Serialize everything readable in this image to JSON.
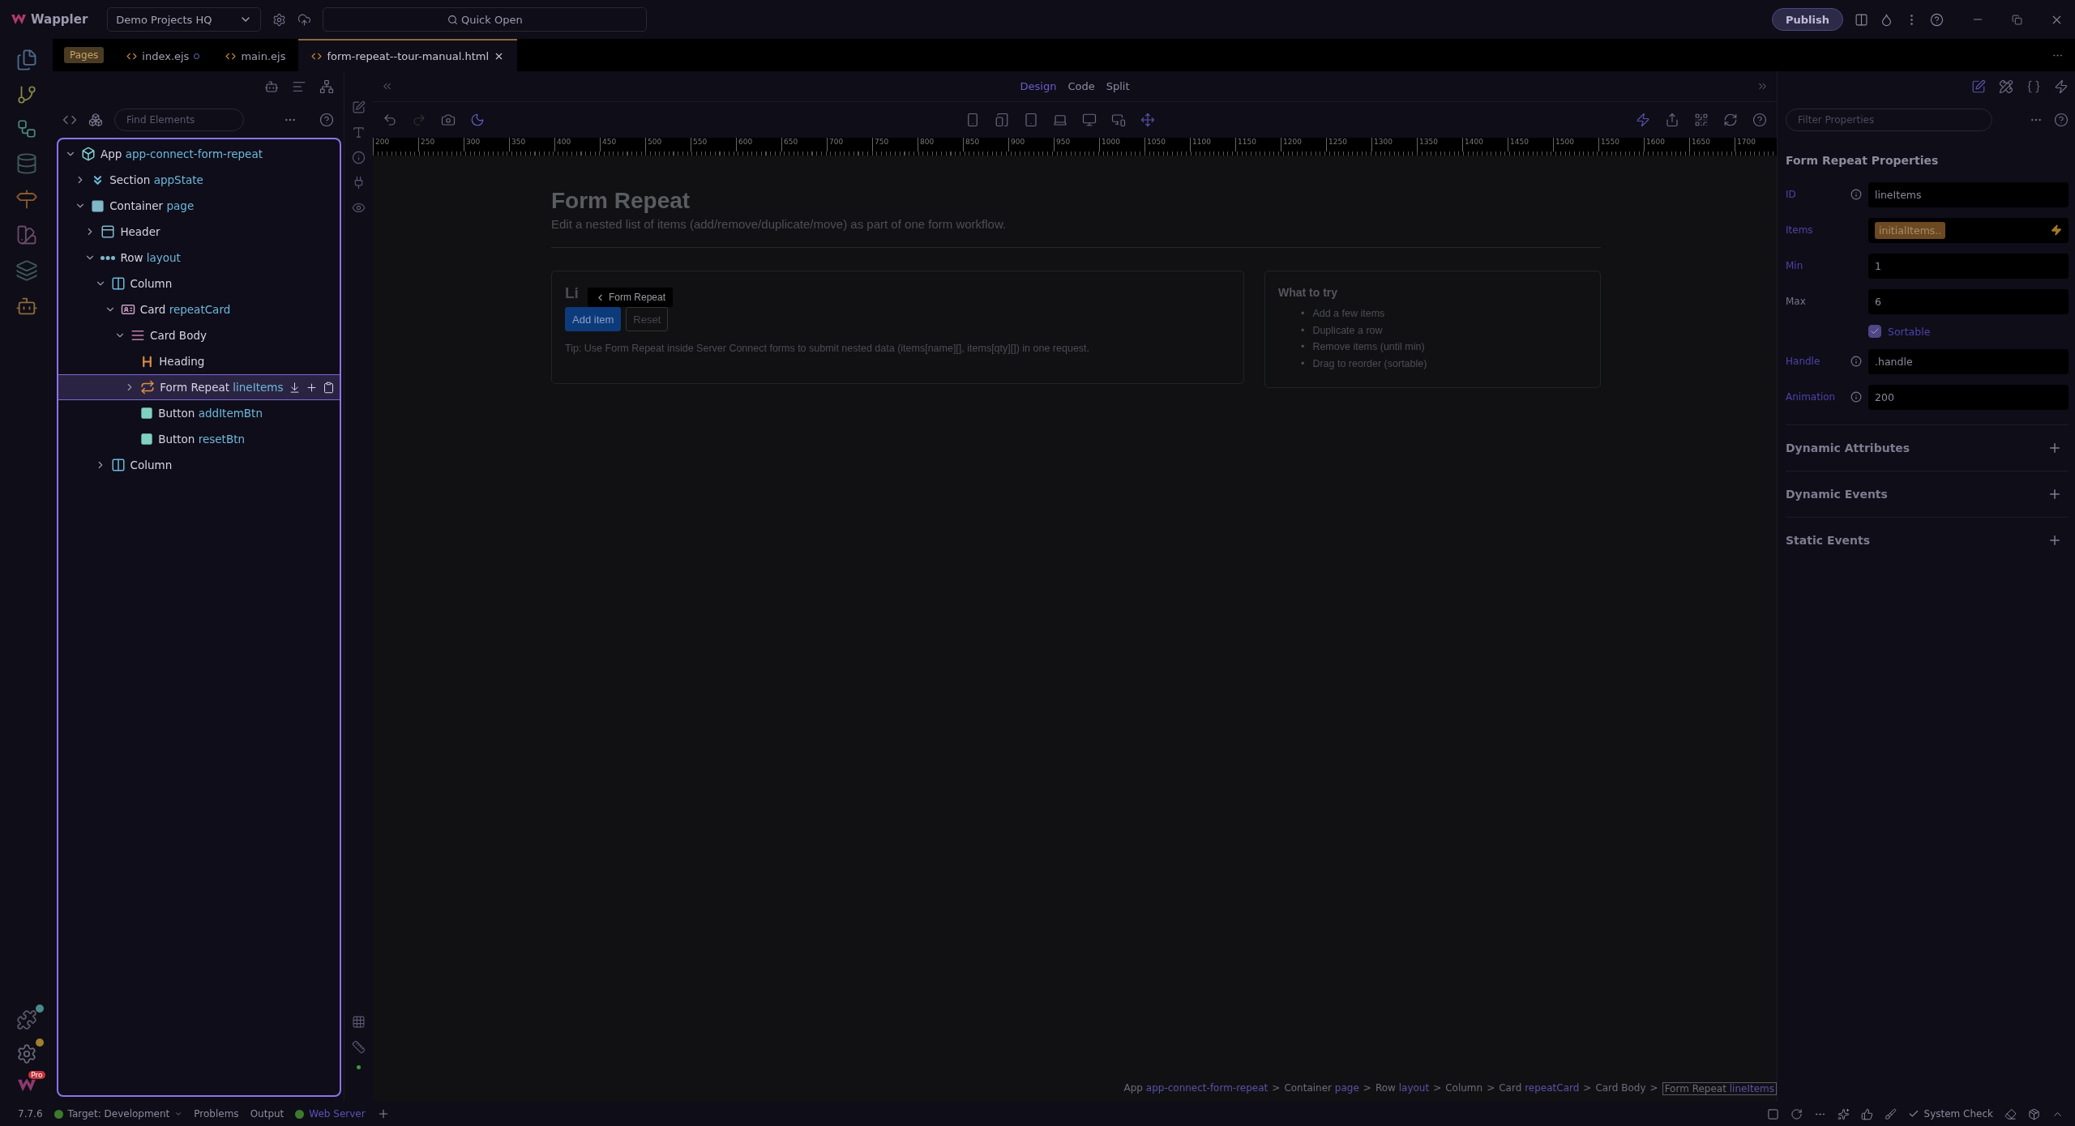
{
  "app": {
    "name": "Wappler",
    "project": "Demo Projects HQ",
    "quick_open": "Quick Open",
    "publish": "Publish"
  },
  "pages_label": "Pages",
  "tabs": [
    {
      "label": "index.ejs",
      "selected": false,
      "modified": true
    },
    {
      "label": "main.ejs",
      "selected": false,
      "modified": false
    },
    {
      "label": "form-repeat--tour-manual.html",
      "selected": true,
      "modified": false
    }
  ],
  "left_panel": {
    "search_placeholder": "Find Elements"
  },
  "tree": [
    {
      "type": "App",
      "id": "app-connect-form-repeat",
      "kind": "app",
      "expanded": true,
      "selected": false,
      "children": [
        {
          "type": "Section",
          "id": "appState",
          "kind": "section",
          "expanded": false,
          "selected": false
        },
        {
          "type": "Container",
          "id": "page",
          "kind": "container",
          "expanded": true,
          "selected": false,
          "children": [
            {
              "type": "Header",
              "kind": "header",
              "expanded": false,
              "selected": false
            },
            {
              "type": "Row",
              "id": "layout",
              "kind": "row",
              "expanded": true,
              "selected": false,
              "children": [
                {
                  "type": "Column",
                  "kind": "column",
                  "expanded": true,
                  "selected": false,
                  "children": [
                    {
                      "type": "Card",
                      "id": "repeatCard",
                      "kind": "card",
                      "expanded": true,
                      "selected": false,
                      "children": [
                        {
                          "type": "Card Body",
                          "kind": "card-body",
                          "expanded": true,
                          "selected": false,
                          "children": [
                            {
                              "type": "Heading",
                              "kind": "heading",
                              "selected": false
                            },
                            {
                              "type": "Form Repeat",
                              "id": "lineItems",
                              "kind": "repeat",
                              "expanded": false,
                              "selected": true
                            },
                            {
                              "type": "Button",
                              "id": "addItemBtn",
                              "kind": "button",
                              "selected": false
                            },
                            {
                              "type": "Button",
                              "id": "resetBtn",
                              "kind": "button",
                              "selected": false
                            }
                          ]
                        }
                      ]
                    }
                  ]
                },
                {
                  "type": "Column",
                  "kind": "column",
                  "expanded": false,
                  "selected": false
                }
              ]
            }
          ]
        }
      ]
    }
  ],
  "view_modes": [
    {
      "label": "Design",
      "selected": true
    },
    {
      "label": "Code",
      "selected": false
    },
    {
      "label": "Split",
      "selected": false
    }
  ],
  "ruler": [
    "200",
    "250",
    "300",
    "350",
    "400",
    "450",
    "500",
    "550",
    "600",
    "650",
    "700",
    "750",
    "800",
    "850",
    "900",
    "950",
    "1000",
    "1050",
    "1100",
    "1150",
    "1200",
    "1250",
    "1300",
    "1350",
    "1400",
    "1450",
    "1500",
    "1550",
    "1600",
    "1650",
    "1700"
  ],
  "page": {
    "title": "Form Repeat",
    "subtitle": "Edit a nested list of items (add/remove/duplicate/move) as part of one form workflow.",
    "card": {
      "heading": "Li",
      "tooltip": "Form Repeat",
      "buttons": [
        {
          "label": "Add item",
          "kind": "primary"
        },
        {
          "label": "Reset",
          "kind": "outline"
        }
      ],
      "tip": "Tip: Use Form Repeat inside Server Connect forms to submit nested data (items[name][], items[qty][]) in one request."
    },
    "side_card": {
      "title": "What to try",
      "items": [
        {
          "bullet": "•",
          "text": "Add a few items"
        },
        {
          "bullet": "•",
          "text": "Duplicate a row"
        },
        {
          "bullet": "•",
          "text": "Remove items (until min)"
        },
        {
          "bullet": "•",
          "text": "Drag to reorder (sortable)"
        }
      ]
    }
  },
  "breadcrumb": [
    {
      "type": "App",
      "id": "app-connect-form-repeat",
      "selected": false,
      "sep": ">"
    },
    {
      "type": "Container",
      "id": "page",
      "selected": false,
      "sep": ">"
    },
    {
      "type": "Row",
      "id": "layout",
      "selected": false,
      "sep": ">"
    },
    {
      "type": "Column",
      "selected": false,
      "sep": ">"
    },
    {
      "type": "Card",
      "id": "repeatCard",
      "selected": false,
      "sep": ">"
    },
    {
      "type": "Card Body",
      "selected": false,
      "sep": ">"
    },
    {
      "type": "Form Repeat",
      "id": "lineItems",
      "selected": true
    }
  ],
  "properties": {
    "filter_placeholder": "Filter Properties",
    "title": "Form Repeat Properties",
    "fields": [
      {
        "kind": "text",
        "label": "ID",
        "set": true,
        "info": true,
        "value": "lineItems"
      },
      {
        "kind": "binding",
        "label": "Items",
        "set": true,
        "value": "initialItems.."
      },
      {
        "kind": "text",
        "label": "Min",
        "set": true,
        "value": "1"
      },
      {
        "kind": "text",
        "label": "Max",
        "set": false,
        "value": "6"
      },
      {
        "kind": "checkbox",
        "label": "Sortable",
        "checked": true
      },
      {
        "kind": "text",
        "label": "Handle",
        "set": true,
        "info": true,
        "value": ".handle"
      },
      {
        "kind": "text",
        "label": "Animation",
        "set": true,
        "info": true,
        "value": "200"
      }
    ],
    "sections": [
      "Dynamic Attributes",
      "Dynamic Events",
      "Static Events"
    ]
  },
  "status": {
    "version": "7.7.6",
    "target": "Target: Development",
    "panels": [
      "Problems",
      "Output"
    ],
    "server": "Web Server",
    "system_check": "System Check"
  },
  "badges": [
    "Pro"
  ]
}
